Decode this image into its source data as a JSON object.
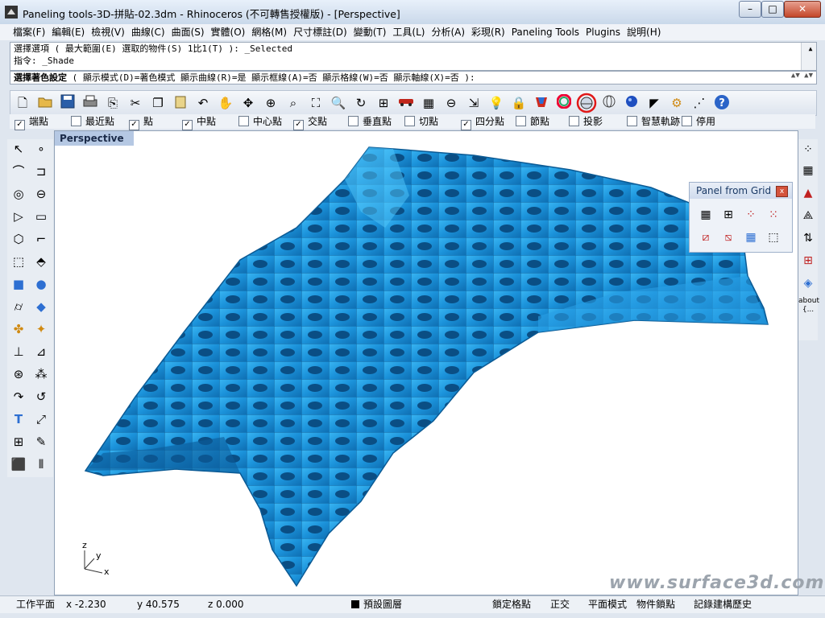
{
  "window": {
    "title": "Paneling tools-3D-拼貼-02.3dm - Rhinoceros (不可轉售授權版) - [Perspective]",
    "minimize": "–",
    "maximize": "□",
    "close": "✕"
  },
  "menu": [
    "檔案(F)",
    "編輯(E)",
    "檢視(V)",
    "曲線(C)",
    "曲面(S)",
    "實體(O)",
    "網格(M)",
    "尺寸標註(D)",
    "變動(T)",
    "工具(L)",
    "分析(A)",
    "彩現(R)",
    "Paneling Tools",
    "Plugins",
    "說明(H)"
  ],
  "command_history": [
    "選擇選項 ( 最大範圍(E) 選取的物件(S) 1比1(T) ): _Selected",
    "指令: _Shade"
  ],
  "command_prompt": {
    "label": "選擇著色設定",
    "rest": " ( 顯示模式(D)=著色模式  顯示曲線(R)=是  顯示框線(A)=否  顯示格線(W)=否  顯示軸線(X)=否 ):"
  },
  "toolbar_icons": [
    "new-icon",
    "open-icon",
    "save-icon",
    "print-icon",
    "import-icon",
    "cut-icon",
    "copy-icon",
    "paste-icon",
    "undo-icon",
    "pan-icon",
    "rotate-view-icon",
    "zoom-icon",
    "zoom-window-icon",
    "zoom-extents-icon",
    "zoom-selected-icon",
    "rotate-icon",
    "four-viewports-icon",
    "car-icon",
    "grid-icon",
    "circle-tool-icon",
    "transform-icon",
    "light-icon",
    "lock-icon",
    "shade-icon",
    "color-wheel-icon",
    "shaded-sphere-icon",
    "wireframe-sphere-icon",
    "render-sphere-icon",
    "render-icon",
    "options-gear-icon",
    "points-icon",
    "help-icon"
  ],
  "osnap": [
    {
      "label": "端點",
      "checked": true
    },
    {
      "label": "最近點",
      "checked": false
    },
    {
      "label": "點",
      "checked": true
    },
    {
      "label": "中點",
      "checked": true
    },
    {
      "label": "中心點",
      "checked": false
    },
    {
      "label": "交點",
      "checked": true
    },
    {
      "label": "垂直點",
      "checked": false
    },
    {
      "label": "切點",
      "checked": false
    },
    {
      "label": "四分點",
      "checked": true
    },
    {
      "label": "節點",
      "checked": false
    },
    {
      "label": "投影",
      "checked": false
    },
    {
      "label": "智慧軌跡",
      "checked": false
    },
    {
      "label": "停用",
      "checked": false
    }
  ],
  "viewport": {
    "label": "Perspective",
    "axis_z": "z",
    "axis_y": "y",
    "axis_x": "x",
    "surface_color": "#1e96dc"
  },
  "panel_from_grid": {
    "title": "Panel from Grid",
    "close": "x"
  },
  "right_toolbar": {
    "about_label": "about"
  },
  "watermark": "www.surface3d.com.tw",
  "status": {
    "cplane": "工作平面",
    "x": "x -2.230",
    "y": "y 40.575",
    "z": "z 0.000",
    "layer": "預設圖層",
    "snap": "鎖定格點",
    "ortho": "正交",
    "planar": "平面模式",
    "osnap": "物件鎖點",
    "history": "記錄建構歷史"
  }
}
